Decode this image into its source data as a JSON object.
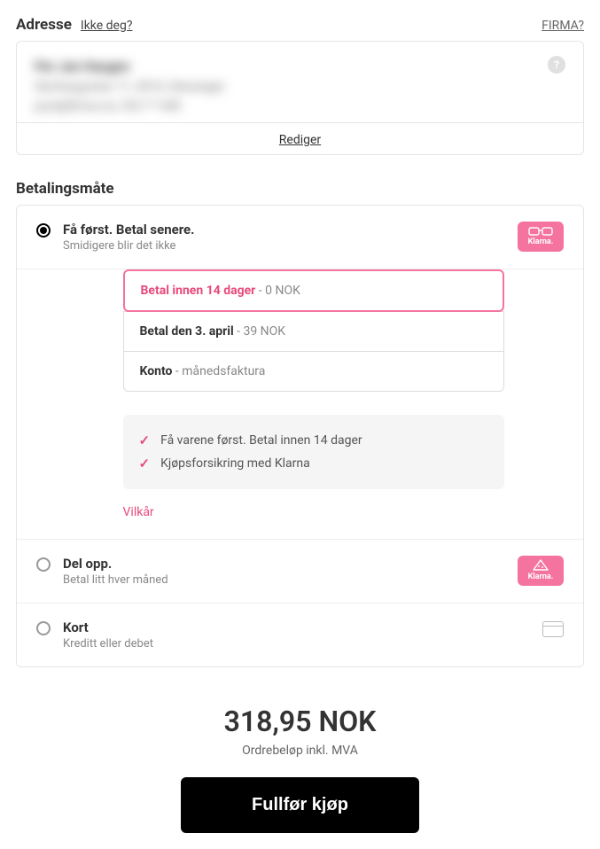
{
  "address": {
    "title": "Adresse",
    "not_you": "Ikke deg?",
    "firma": "FIRMA?",
    "line1": "Per Jan Haugen",
    "line2": "Storhaugveien 11, 4016, Stavanger",
    "line3": "post@firma.no, 922 ** 448",
    "edit": "Rediger"
  },
  "payment": {
    "title": "Betalingsmåte",
    "options": [
      {
        "title": "Få først. Betal senere.",
        "sub": "Smidigere blir det ikke",
        "klarna_label": "Klarna.",
        "selected": true
      },
      {
        "title": "Del opp.",
        "sub": "Betal litt hver måned",
        "klarna_label": "Klarna.",
        "selected": false
      },
      {
        "title": "Kort",
        "sub": "Kreditt eller debet",
        "selected": false
      }
    ],
    "sub_options": [
      {
        "title": "Betal innen 14 dager",
        "price": " - 0 NOK",
        "active": true
      },
      {
        "title": "Betal den 3. april",
        "price": " - 39 NOK",
        "active": false
      },
      {
        "title": "Konto",
        "price": " - månedsfaktura",
        "active": false
      }
    ],
    "benefits": [
      "Få varene først. Betal innen 14 dager",
      "Kjøpsforsikring med Klarna"
    ],
    "terms": "Vilkår"
  },
  "totals": {
    "amount": "318,95 NOK",
    "label": "Ordrebeløp inkl. MVA",
    "cta": "Fullfør kjøp"
  }
}
